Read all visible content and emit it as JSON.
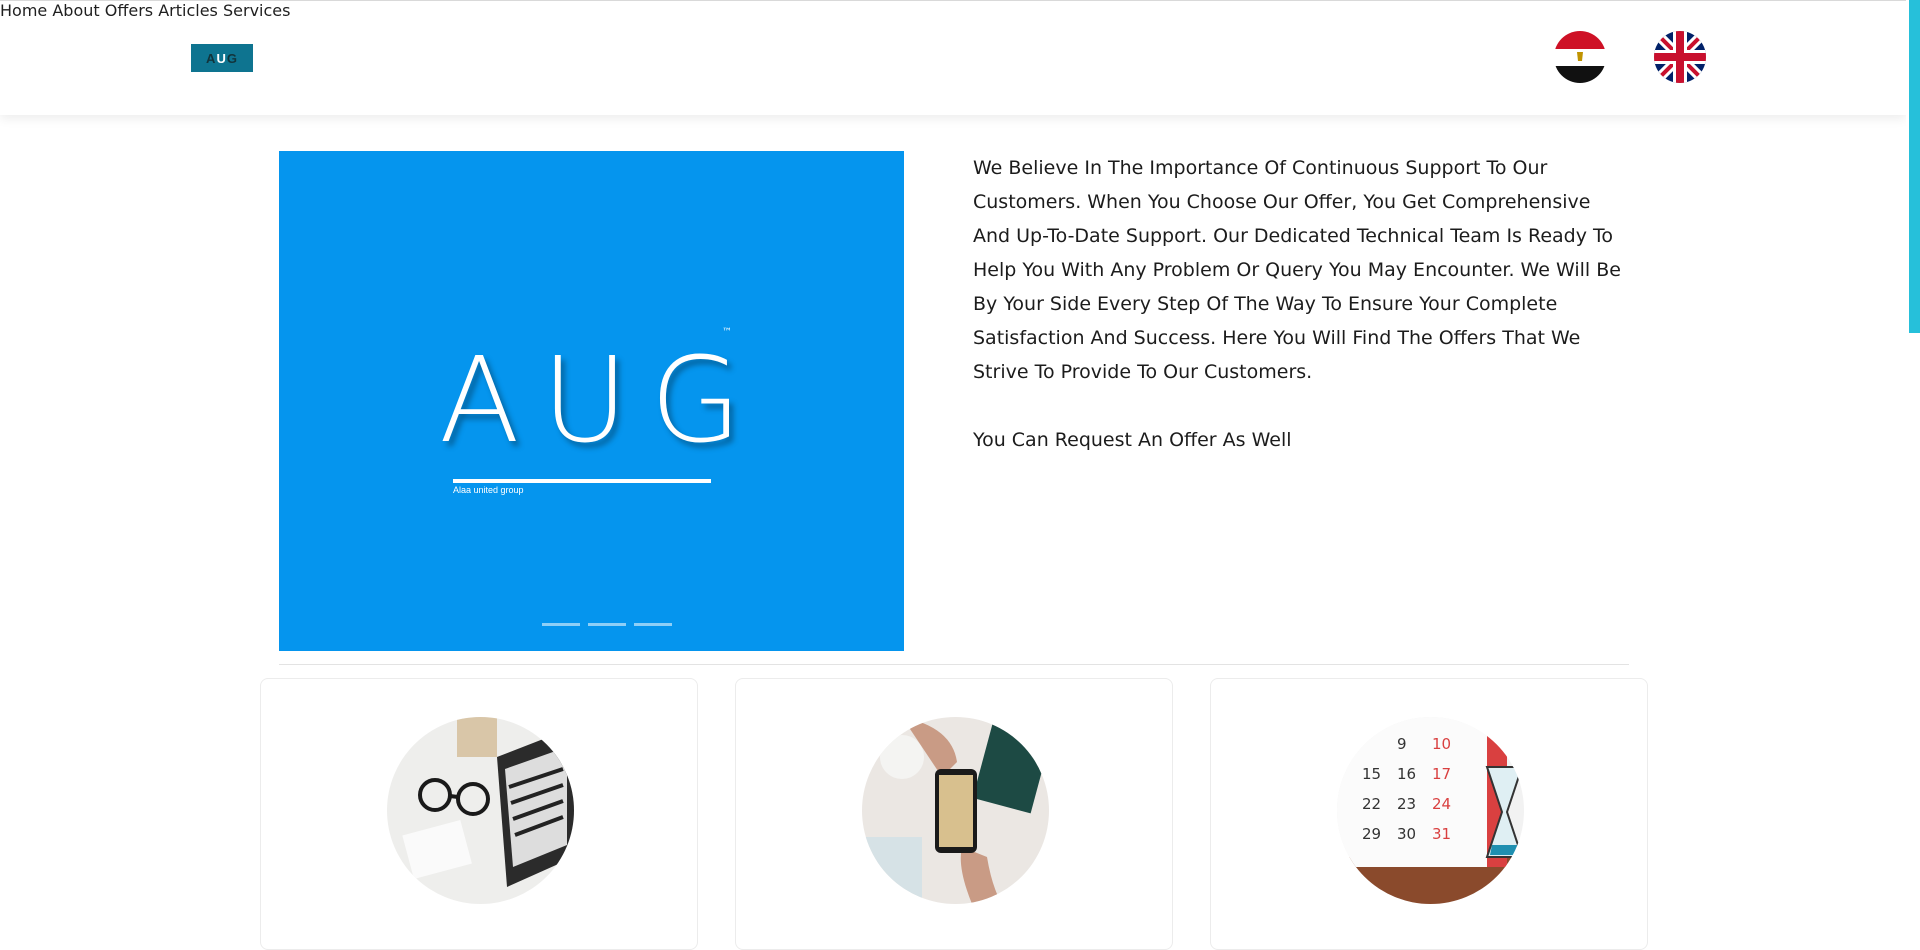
{
  "header": {
    "logo_text_left": "A",
    "logo_text_mid": "U",
    "logo_text_right": "G",
    "nav": [
      "Home",
      "About",
      "Offers",
      "Articles",
      "Services"
    ],
    "languages": [
      "egypt-flag-icon",
      "uk-flag-icon"
    ]
  },
  "slider": {
    "logo": "AUG",
    "trademark": "™",
    "tagline": "Alaa united group",
    "slide_count": 3
  },
  "intro": {
    "paragraph": "We Believe In The Importance Of Continuous Support To Our Customers. When You Choose Our Offer, You Get Comprehensive And Up-To-Date Support. Our Dedicated Technical Team Is Ready To Help You With Any Problem Or Query You May Encounter. We Will Be By Your Side Every Step Of The Way To Ensure Your Complete Satisfaction And Success. Here You Will Find The Offers That We Strive To Provide To Our Customers.",
    "request_line": "You Can Request An Offer As Well"
  },
  "cards": [
    {
      "image": "laptop-glasses-image"
    },
    {
      "image": "phone-hands-image"
    },
    {
      "image": "calendar-hourglass-image"
    }
  ],
  "colors": {
    "slider_bg": "#0595ee",
    "logo_bg": "#0e7490",
    "scroll_thumb": "#26c0da"
  }
}
